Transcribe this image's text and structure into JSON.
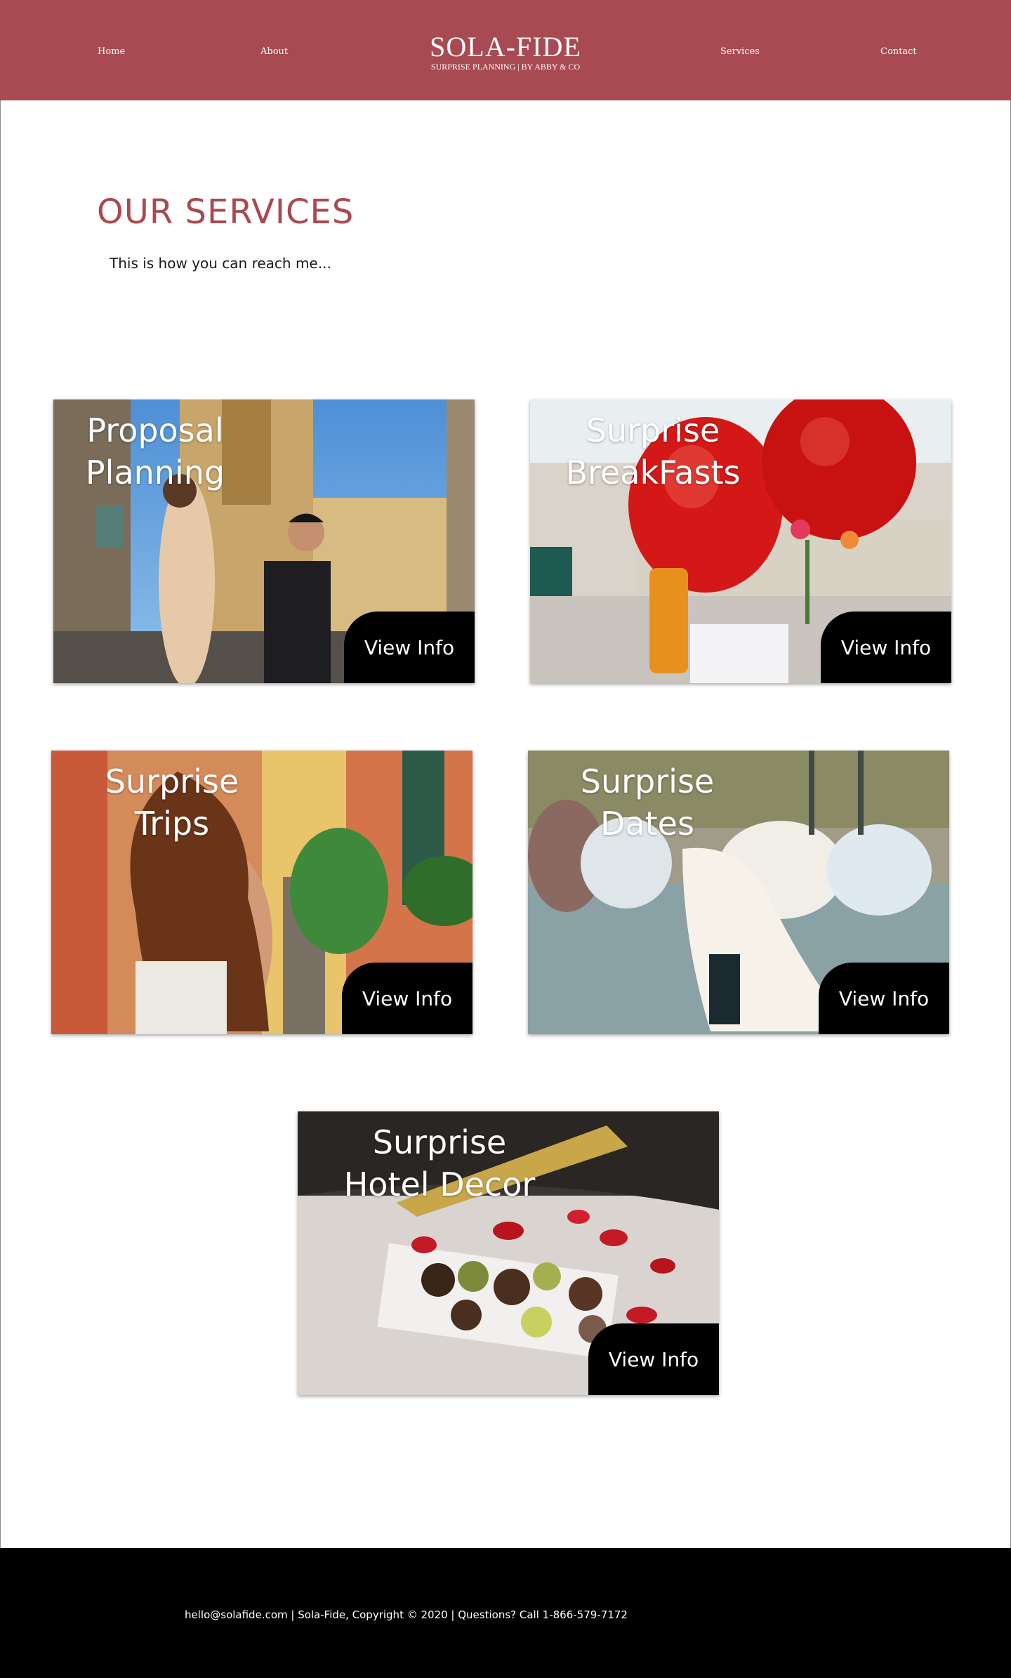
{
  "header": {
    "nav_left": [
      "Home",
      "About"
    ],
    "brand_title": "SOLA-FIDE",
    "brand_subtitle": "SURPRISE PLANNING | BY ABBY & CO",
    "nav_right": [
      "Services",
      "Contact"
    ],
    "background": "#a84a51"
  },
  "main": {
    "title": "OUR SERVICES",
    "intro": "This is how you can reach me...",
    "accent_color": "#a84a51"
  },
  "cards": [
    {
      "title_line1": "Proposal",
      "title_line2": "Planning",
      "button": "View Info",
      "photo": "couple proposal street photo"
    },
    {
      "title_line1": "Surprise",
      "title_line2": "BreakFasts",
      "button": "View Info",
      "photo": "red balloons breakfast photo"
    },
    {
      "title_line1": "Surprise",
      "title_line2": "Trips",
      "button": "View Info",
      "photo": "woman curly hair alley photo"
    },
    {
      "title_line1": "Surprise",
      "title_line2": "Dates",
      "button": "View Info",
      "photo": "beach picnic blankets photo"
    },
    {
      "title_line1": "Surprise",
      "title_line2": "Hotel Decor",
      "button": "View Info",
      "photo": "chocolates rose petals champagne photo"
    }
  ],
  "footer": {
    "text": "hello@solafide.com | Sola-Fide, Copyright © 2020 | Questions? Call 1-866-579-7172",
    "background": "#000000"
  }
}
